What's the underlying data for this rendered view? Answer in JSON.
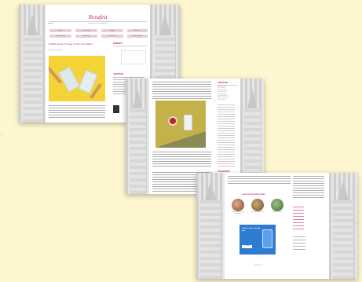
{
  "logo": {
    "word": "Nevafest",
    "tagline": "Beauty, zero waste lifestyle"
  },
  "nav": [
    "Beauty",
    "Zero waste",
    "Lifestyle",
    "Ékszerek",
    "Kosmetikumok",
    "Egészség",
    "Outfit & stílus",
    "Otthon & design",
    "Kontakt"
  ],
  "post1": {
    "title": "Szilárd sampon? Hogy mi az? Itt a válasz!",
    "subtitle": "Zero waste lifestyle"
  },
  "sidebar": {
    "search": "KERESÉS",
    "archive": "ARCHÍVUM",
    "categories": "KATEGÓRIÁK"
  },
  "archive_items": [
    "2021 május (4)",
    "2021 április (6)",
    "2021 március (5)",
    "2021 február (4)",
    "2021 január (7)",
    "2020 december (5)",
    "2020 november (6)",
    "2020 október (4)"
  ],
  "shot3": {
    "section": "KAPCSOLÓDÓ BEJEGYZÉSEK",
    "promo": "Zöldebb otthon, tisztább jövő",
    "promo_cta": "TOVÁBB",
    "cards": [
      "Hogyan készíts szilárd samponokat?",
      "Zero waste fürdőszoba",
      "Bambusz fogkefe"
    ],
    "footer": "© 2021 Nevafest"
  },
  "colors": {
    "brand": "#c2185b",
    "background": "#fdf6cf",
    "mustard": "#c5b14a",
    "promo": "#2f7bd2"
  }
}
